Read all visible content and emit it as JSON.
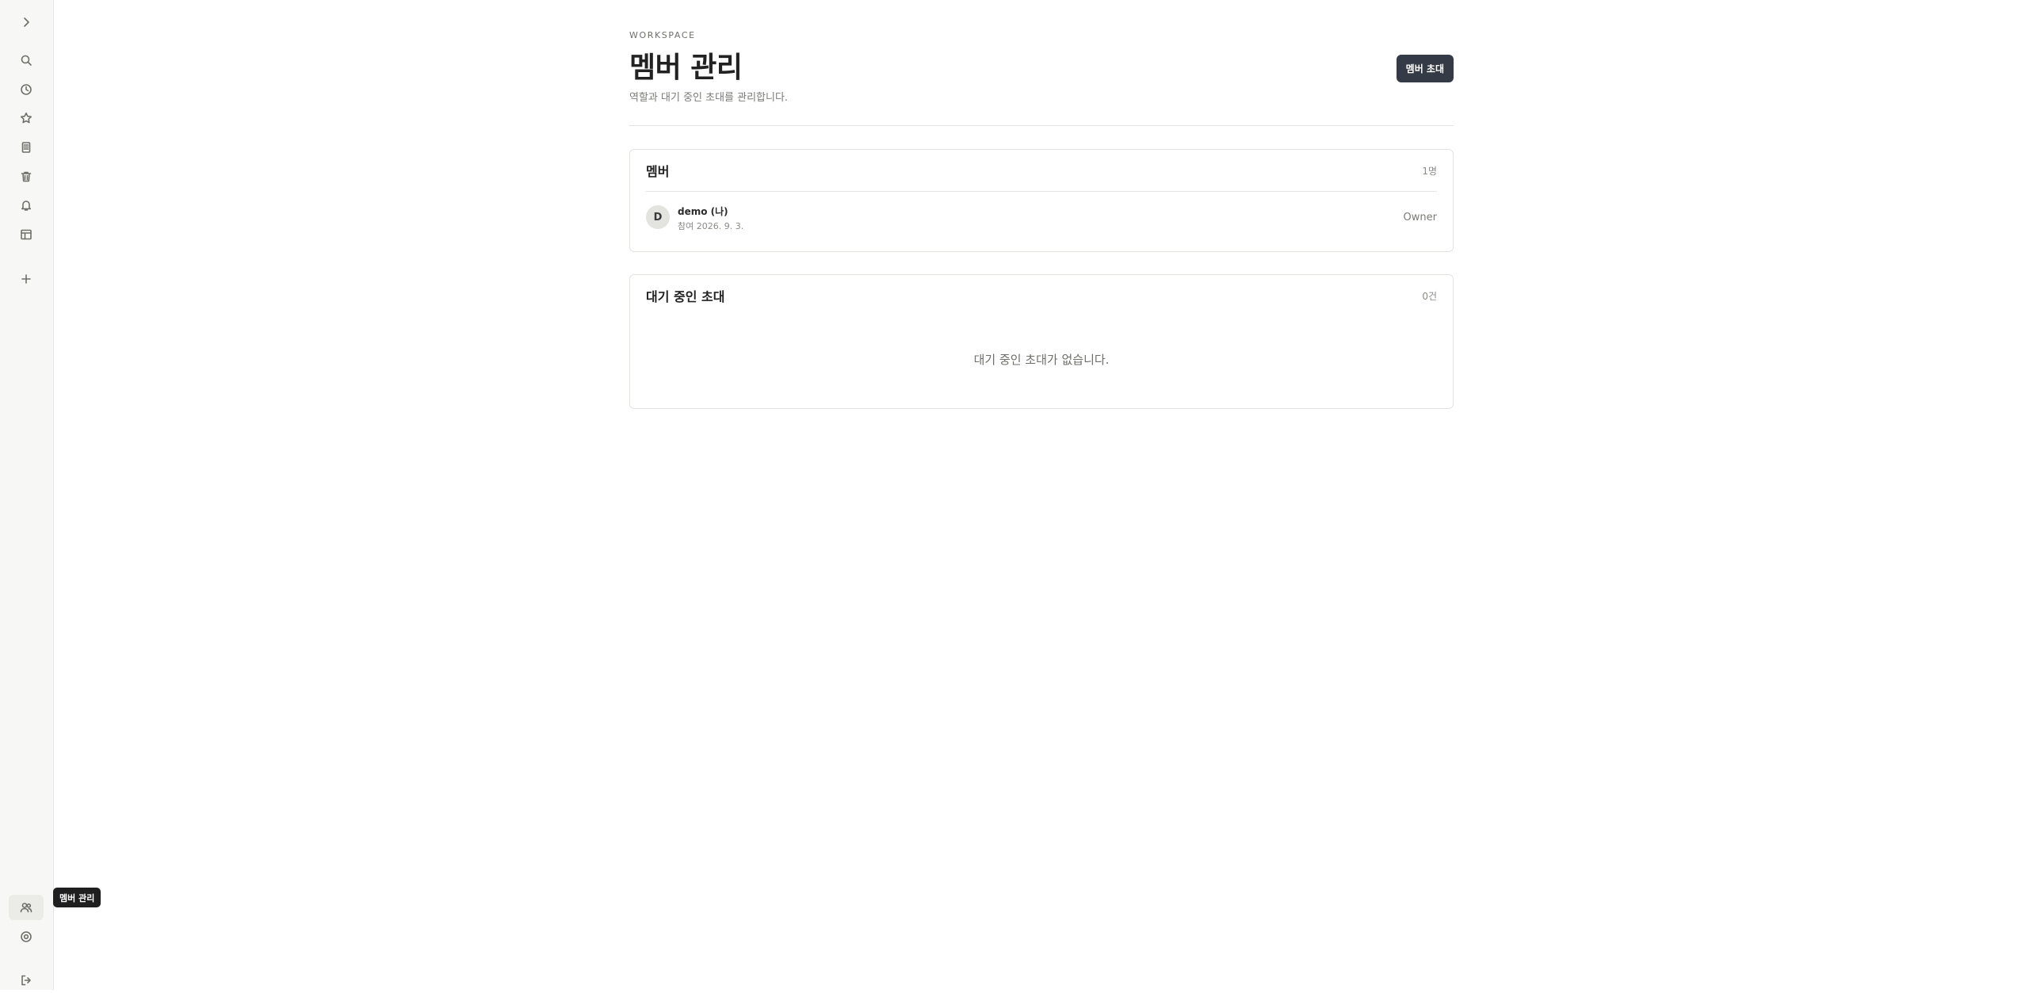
{
  "sidebar": {
    "expand_icon": "chevron-right-icon",
    "items": [
      {
        "name": "search",
        "icon": "search-icon"
      },
      {
        "name": "recent",
        "icon": "clock-icon"
      },
      {
        "name": "favorites",
        "icon": "star-icon"
      },
      {
        "name": "documents",
        "icon": "document-icon"
      },
      {
        "name": "trash",
        "icon": "trash-icon"
      },
      {
        "name": "notifications",
        "icon": "bell-icon"
      },
      {
        "name": "templates",
        "icon": "layout-icon"
      },
      {
        "name": "add",
        "icon": "plus-icon"
      }
    ],
    "bottom": [
      {
        "name": "members",
        "icon": "users-icon",
        "active": true
      },
      {
        "name": "settings",
        "icon": "settings-icon"
      },
      {
        "name": "logout",
        "icon": "logout-icon"
      }
    ],
    "tooltip": "멤버 관리"
  },
  "header": {
    "eyebrow": "WORKSPACE",
    "title": "멤버 관리",
    "subtitle": "역할과 대기 중인 초대를 관리합니다.",
    "invite_button": "멤버 초대"
  },
  "members_card": {
    "title": "멤버",
    "count": "1명",
    "members": [
      {
        "avatar": "D",
        "name": "demo (나)",
        "joined": "참여 2026. 9. 3.",
        "role": "Owner"
      }
    ]
  },
  "invites_card": {
    "title": "대기 중인 초대",
    "count": "0건",
    "empty_message": "대기 중인 초대가 없습니다."
  },
  "colors": {
    "primary_button": "#343a46",
    "sidebar_bg": "#f7f7f5",
    "tooltip_bg": "#1f1f1f"
  }
}
